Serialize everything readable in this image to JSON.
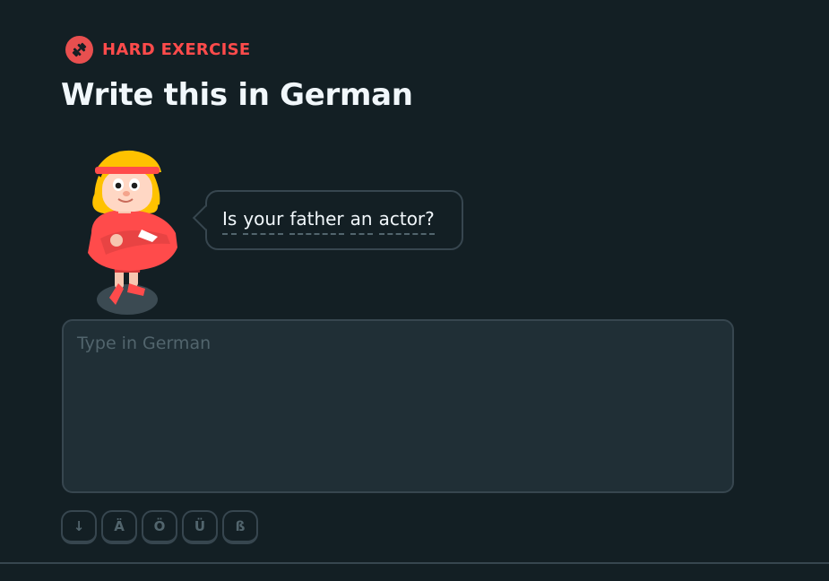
{
  "exercise": {
    "badge_label": "HARD EXERCISE",
    "badge_icon": "dumbbell-icon",
    "title": "Write this in German"
  },
  "prompt": {
    "words": [
      "Is",
      "your",
      "father",
      "an",
      "actor?"
    ]
  },
  "answer": {
    "value": "",
    "placeholder": "Type in German"
  },
  "special_keys": [
    "↓",
    "Ä",
    "Ö",
    "Ü",
    "ß"
  ],
  "colors": {
    "background": "#131f24",
    "accent_red": "#ff4b4b",
    "border": "#37464f",
    "input_bg": "#202f36",
    "placeholder": "#52656d"
  }
}
